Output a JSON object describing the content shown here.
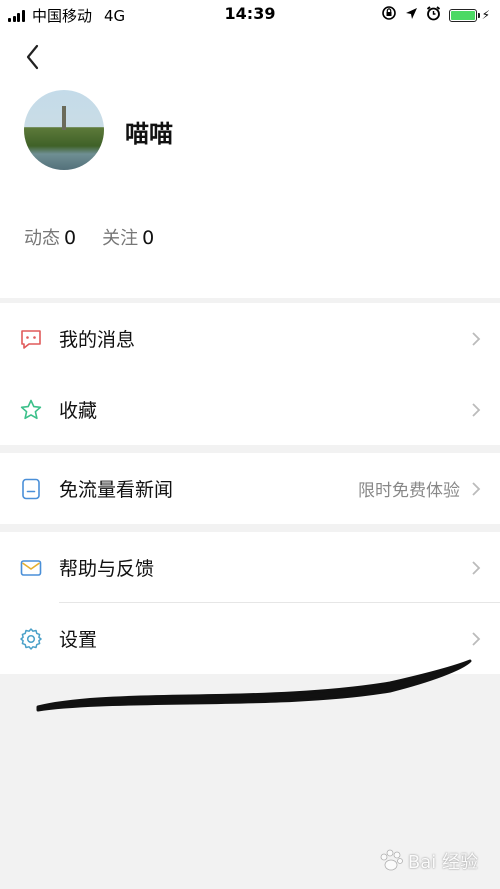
{
  "status_bar": {
    "carrier": "中国移动",
    "network": "4G",
    "time": "14:39"
  },
  "profile": {
    "username": "喵喵",
    "stats": [
      {
        "label": "动态",
        "value": "0"
      },
      {
        "label": "关注",
        "value": "0"
      }
    ]
  },
  "menu": {
    "messages": {
      "label": "我的消息",
      "icon": "message-icon"
    },
    "favorites": {
      "label": "收藏",
      "icon": "star-icon"
    },
    "free_data": {
      "label": "免流量看新闻",
      "extra": "限时免费体验",
      "icon": "sim-card-icon"
    },
    "help": {
      "label": "帮助与反馈",
      "icon": "mail-icon"
    },
    "settings": {
      "label": "设置",
      "icon": "gear-icon"
    }
  },
  "watermark": {
    "text": "Bai 经验"
  },
  "colors": {
    "message_icon": "#e05a5a",
    "star_icon": "#3cc08a",
    "sim_icon": "#4a8fd8",
    "mail_icon": "#e6b030",
    "gear_icon": "#4aa0c8",
    "battery": "#4cd964"
  }
}
